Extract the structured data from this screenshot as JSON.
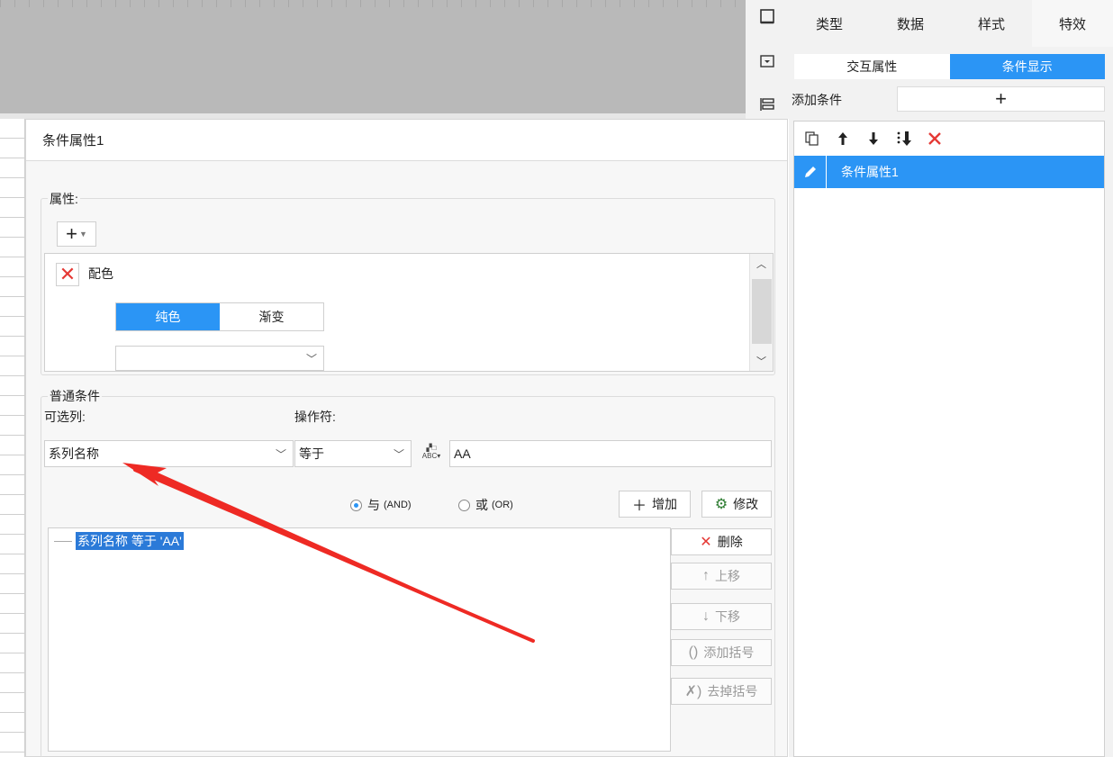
{
  "right_panel": {
    "tabs": [
      "类型",
      "数据",
      "样式",
      "特效"
    ],
    "active_tab": 3,
    "subtabs": [
      "交互属性",
      "条件显示"
    ],
    "active_subtab": 1,
    "add_condition_label": "添加条件",
    "add_condition_button": "+",
    "list_items": [
      "条件属性1"
    ]
  },
  "dialog": {
    "title": "条件属性1",
    "properties_label": "属性:",
    "add_button": "+",
    "property_name": "配色",
    "color_modes": [
      "纯色",
      "渐变"
    ],
    "active_color_mode": 0,
    "common_conditions_label": "普通条件",
    "column_label": "可选列:",
    "operator_label": "操作符:",
    "column_value": "系列名称",
    "operator_value": "等于",
    "value_input": "AA",
    "and_label": "与",
    "and_sub": "(AND)",
    "or_label": "或",
    "or_sub": "(OR)",
    "and_selected": true,
    "add_label": "增加",
    "modify_label": "修改",
    "delete_label": "删除",
    "move_up_label": "上移",
    "move_down_label": "下移",
    "add_bracket_label": "添加括号",
    "remove_bracket_label": "去掉括号",
    "expression": "系列名称 等于 'AA'"
  },
  "colors": {
    "accent": "#2b95f5",
    "delete_red": "#e53935",
    "annotation_arrow": "#ee2a24"
  },
  "icons": {
    "toolbar": [
      "square-icon",
      "dropdown-box-icon",
      "align-icon"
    ],
    "list_toolbar": [
      "copy-icon",
      "arrow-up-icon",
      "arrow-down-icon",
      "move-bottom-icon",
      "delete-icon"
    ]
  }
}
